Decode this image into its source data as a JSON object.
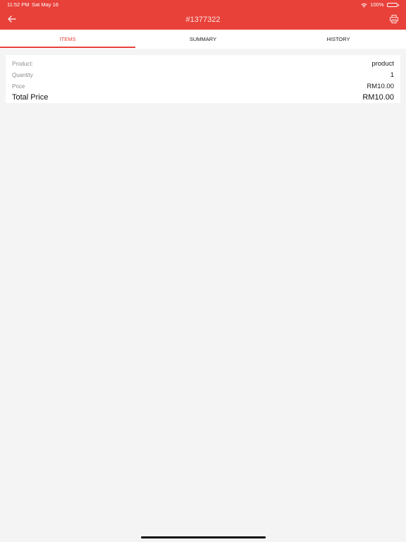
{
  "status_bar": {
    "time": "11:52 PM",
    "date": "Sat May 16",
    "battery": "100%"
  },
  "nav": {
    "title": "#1377322",
    "back_icon": "back-arrow-icon",
    "print_icon": "printer-icon"
  },
  "tabs": [
    {
      "label": "ITEMS",
      "active": true
    },
    {
      "label": "SUMMARY",
      "active": false
    },
    {
      "label": "HISTORY",
      "active": false
    }
  ],
  "item": {
    "rows": [
      {
        "label": "Product:",
        "value": "product"
      },
      {
        "label": "Quantity",
        "value": "1"
      },
      {
        "label": "Price",
        "value": "RM10.00"
      }
    ],
    "total": {
      "label": "Total Price",
      "value": "RM10.00"
    }
  },
  "colors": {
    "accent": "#e8413a",
    "background": "#f5f4f4"
  }
}
